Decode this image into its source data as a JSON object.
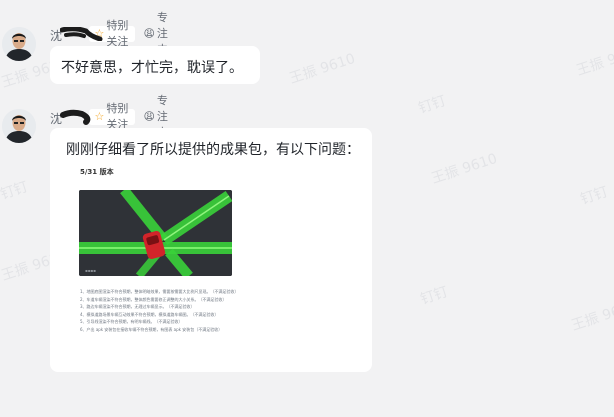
{
  "messages": [
    {
      "sender_name": "沈",
      "badges": {
        "special_follow": "特别关注",
        "focus": "专注中"
      },
      "text": "不好意思，才忙完，耽误了。"
    },
    {
      "sender_name": "沈",
      "badges": {
        "special_follow": "特别关注",
        "focus": "专注中"
      },
      "text": "刚刚仔细看了所以提供的成果包，有以下问题：",
      "attachment": {
        "doc_title": "5/31 版本",
        "items": [
          "1、地图底图渲染不符合预期，整体明暗效果，需要按需要大比例尺显现。（不满足验收）",
          "2、车道车辆渲染不符合预期，整体颜色需要修正调整的大小关系。（不满足验收）",
          "3、路边车辆渲染不符合预期，无理过车辆显示。（不满足验收）",
          "4、模拟道路场景车辆互动效果不符合预期，模拟道路车辆图。（不满足验收）",
          "5、引导线渲染不符合预期，有明车辆线。（不满足验收）",
          "6、产出 apk 安装包在接收车辆不符合预期，有图表 apk 安装包（不满足验收）"
        ]
      }
    }
  ],
  "watermarks": [
    "王振 9610",
    "钉钉"
  ]
}
